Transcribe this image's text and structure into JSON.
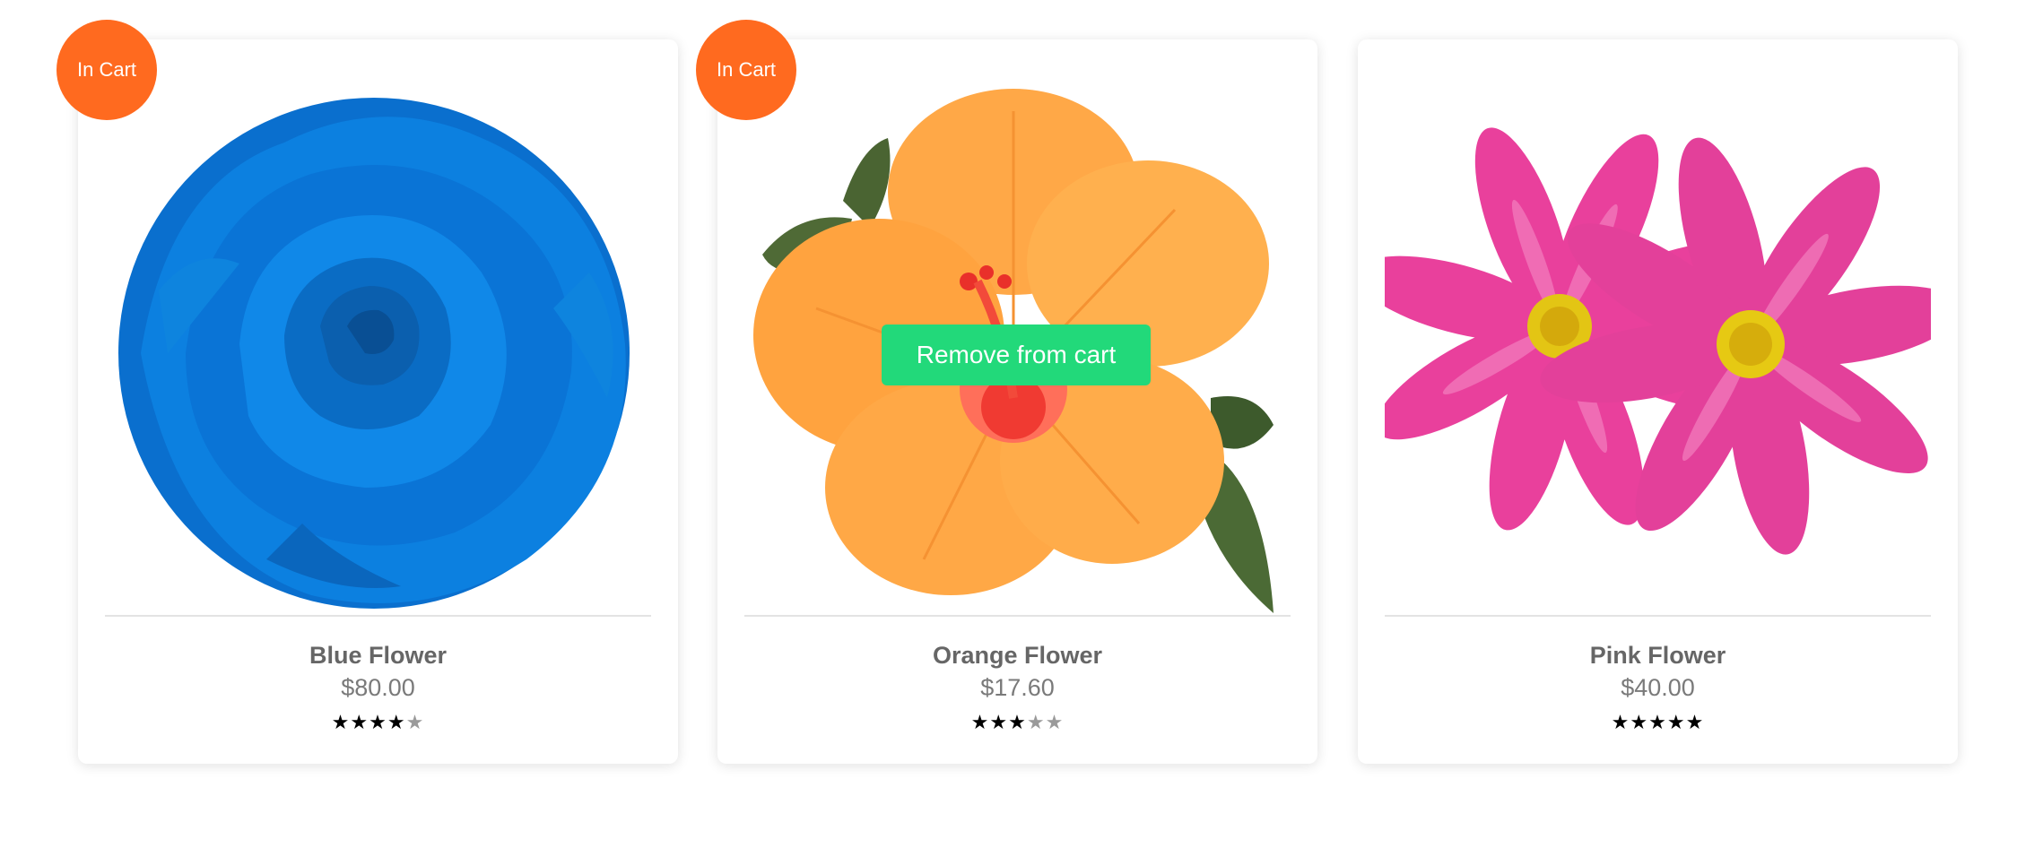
{
  "colors": {
    "badge": "#ff6a1f",
    "button": "#22d97a",
    "title_text": "#666666",
    "price_text": "#7a7a7a",
    "star_on": "#000000",
    "star_off": "#9a9a9a"
  },
  "products": [
    {
      "name": "Blue Flower",
      "price": "$80.00",
      "rating": 4,
      "rating_max": 5,
      "badge": "In Cart",
      "image_icon": "blue-rose-image"
    },
    {
      "name": "Orange Flower",
      "price": "$17.60",
      "rating": 3,
      "rating_max": 5,
      "badge": "In Cart",
      "image_icon": "orange-hibiscus-image"
    },
    {
      "name": "Pink Flower",
      "price": "$40.00",
      "rating": 5,
      "rating_max": 5,
      "badge": "",
      "image_icon": "pink-cosmos-image"
    }
  ],
  "hover_action": {
    "label": "Remove from cart"
  }
}
